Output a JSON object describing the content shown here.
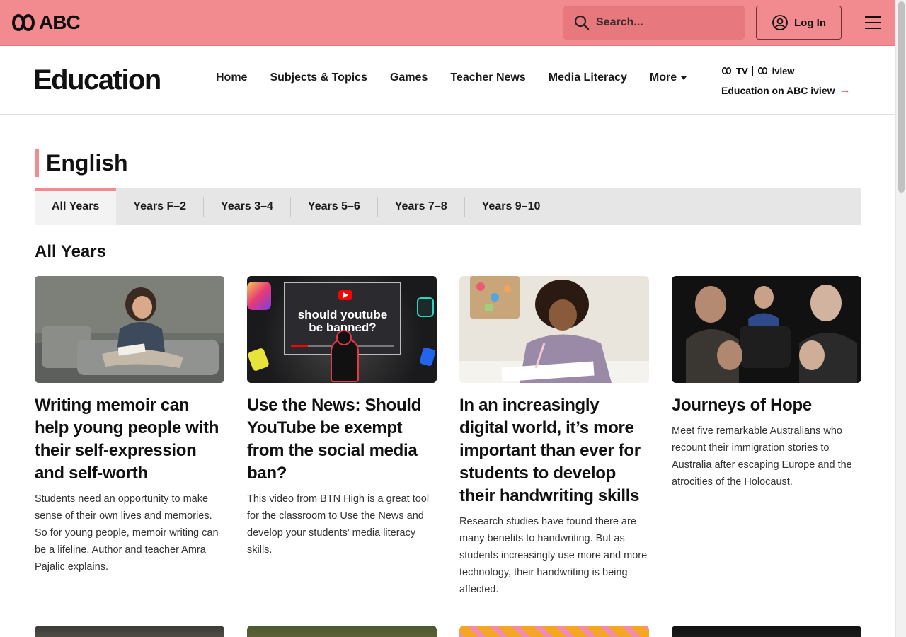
{
  "header": {
    "logo_text": "ABC",
    "search_placeholder": "Search...",
    "login_label": "Log In"
  },
  "section": {
    "brand": "Education",
    "nav": [
      "Home",
      "Subjects & Topics",
      "Games",
      "Teacher News",
      "Media Literacy",
      "More"
    ],
    "iview_tv": "TV",
    "iview_name": "iview",
    "iview_link": "Education on ABC iview"
  },
  "page": {
    "title": "English",
    "tabs": [
      "All Years",
      "Years F–2",
      "Years 3–4",
      "Years 5–6",
      "Years 7–8",
      "Years 9–10"
    ],
    "active_tab": "All Years",
    "heading": "All Years"
  },
  "cards": [
    {
      "title": "Writing memoir can help young people with their self-expression and self-worth",
      "description": "Students need an opportunity to make sense of their own lives and memories. So for young people, memoir writing can be a lifeline. Author and teacher Amra Pajalic explains."
    },
    {
      "title": "Use the News: Should YouTube be exempt from the social media ban?",
      "description": "This video from BTN High is a great tool for the classroom to Use the News and develop your students' media literacy skills.",
      "thumb_text_line1": "should youtube",
      "thumb_text_line2": "be banned?"
    },
    {
      "title": "In an increasingly digital world, it’s more important than ever for students to develop their handwriting skills",
      "description": "Research studies have found there are many benefits to handwriting. But as students increasingly use more and more technology, their handwriting is being affected."
    },
    {
      "title": "Journeys of Hope",
      "description": "Meet five remarkable Australians who recount their immigration stories to Australia after escaping Europe and the atrocities of the Holocaust."
    }
  ],
  "colors": {
    "brand_pink": "#f28b8f",
    "accent_red": "#d6323f"
  }
}
